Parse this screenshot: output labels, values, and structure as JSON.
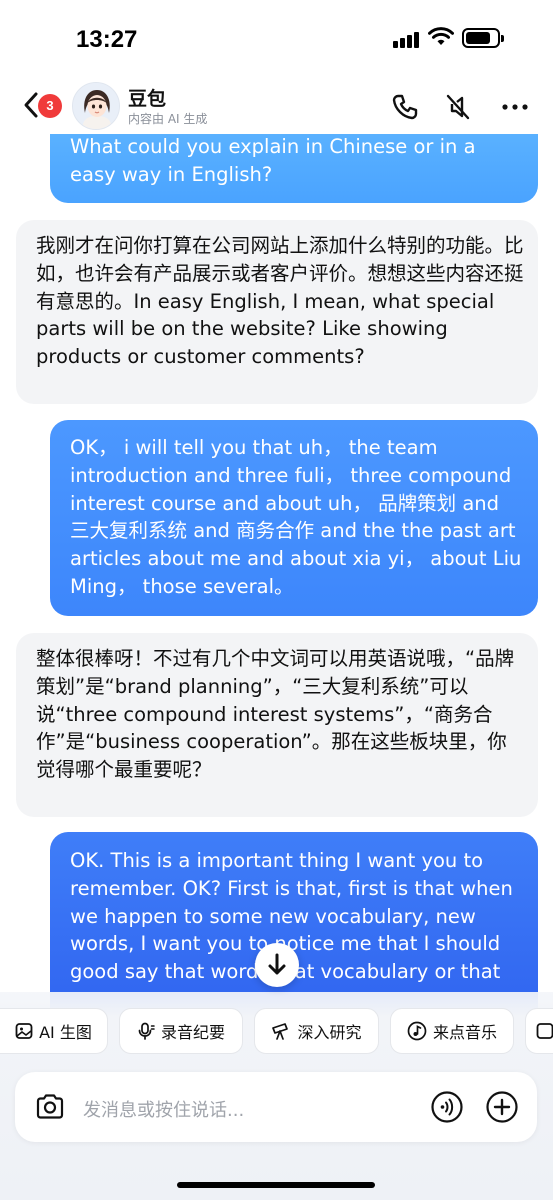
{
  "status_bar": {
    "time": "13:27"
  },
  "header": {
    "back_badge": "3",
    "bot_name": "豆包",
    "bot_subtitle": "内容由 AI 生成"
  },
  "messages": [
    {
      "role": "user",
      "text": "What could you explain in Chinese or in a easy way in English?"
    },
    {
      "role": "bot",
      "text": "我刚才在问你打算在公司网站上添加什么特别的功能。比如，也许会有产品展示或者客户评价。想想这些内容还挺有意思的。In easy English, I mean, what special parts will be on the website? Like showing products or customer comments?"
    },
    {
      "role": "user",
      "text": "OK， i will tell you that uh， the team introduction and three fuli， three compound interest course and about uh， 品牌策划 and 三大复利系统 and 商务合作 and the the past art articles about me and about xia yi， about Liu Ming， those several。"
    },
    {
      "role": "bot",
      "text": "整体很棒呀！不过有几个中文词可以用英语说哦，“品牌策划”是“brand planning”，“三大复利系统”可以说“three compound interest systems”，“商务合作”是“business cooperation”。那在这些板块里，你觉得哪个最重要呢？"
    },
    {
      "role": "user",
      "text": "OK. This is a important thing I want you to remember. OK? First is that, first is that when we happen to some new vocabulary, new words, I want you to notice me that I should good say that words that vocabulary or that"
    }
  ],
  "toolbar": {
    "chips": [
      {
        "label": "AI 生图",
        "icon": "image-icon"
      },
      {
        "label": "录音纪要",
        "icon": "mic-icon"
      },
      {
        "label": "深入研究",
        "icon": "telescope-icon"
      },
      {
        "label": "来点音乐",
        "icon": "music-icon"
      }
    ]
  },
  "input": {
    "placeholder": "发消息或按住说话..."
  },
  "colors": {
    "user_bubble_top": "#5fb6ff",
    "user_bubble_mid": "#4c98ff",
    "user_bubble_bottom": "#2f62ef",
    "bot_bubble": "#f3f4f6",
    "badge": "#f03a3a"
  }
}
